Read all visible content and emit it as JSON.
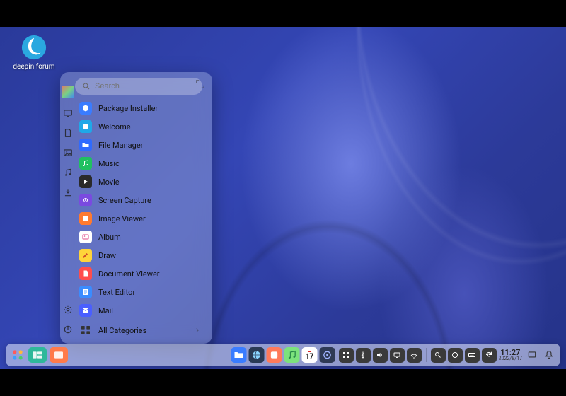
{
  "desktop_shortcut": {
    "label": "deepin forum"
  },
  "launcher": {
    "search_placeholder": "Search",
    "apps": [
      {
        "label": "Package Installer",
        "icon": "package-installer-icon",
        "bg": "#3a7cff"
      },
      {
        "label": "Welcome",
        "icon": "welcome-icon",
        "bg": "#1fa8e8"
      },
      {
        "label": "File Manager",
        "icon": "file-manager-icon",
        "bg": "#2f6bff"
      },
      {
        "label": "Music",
        "icon": "music-icon",
        "bg": "#20c060"
      },
      {
        "label": "Movie",
        "icon": "movie-icon",
        "bg": "#2a2a2a"
      },
      {
        "label": "Screen Capture",
        "icon": "screen-capture-icon",
        "bg": "#7a4ae0"
      },
      {
        "label": "Image Viewer",
        "icon": "image-viewer-icon",
        "bg": "#ff7a2f"
      },
      {
        "label": "Album",
        "icon": "album-icon",
        "bg": "#ffffff"
      },
      {
        "label": "Draw",
        "icon": "draw-icon",
        "bg": "#ffd43a"
      },
      {
        "label": "Document Viewer",
        "icon": "document-viewer-icon",
        "bg": "#ff4d4d"
      },
      {
        "label": "Text Editor",
        "icon": "text-editor-icon",
        "bg": "#3a8cff"
      },
      {
        "label": "Mail",
        "icon": "mail-icon",
        "bg": "#4a5fff"
      }
    ],
    "all_categories_label": "All Categories"
  },
  "dock": {
    "center_apps": [
      {
        "name": "file-manager",
        "bg": "#3a7cff"
      },
      {
        "name": "browser",
        "bg": "#2a3a55"
      },
      {
        "name": "app-store",
        "bg": "#ff7a5a"
      },
      {
        "name": "music",
        "bg": "#7ce27c"
      },
      {
        "name": "calendar",
        "bg": "#ffffff",
        "text": "17"
      },
      {
        "name": "control-center",
        "bg": "#2f3a55"
      }
    ],
    "tray": [
      {
        "name": "grid-icon"
      },
      {
        "name": "usb-icon"
      },
      {
        "name": "volume-icon"
      },
      {
        "name": "display-icon"
      },
      {
        "name": "network-icon"
      }
    ],
    "tray2": [
      {
        "name": "search-icon"
      },
      {
        "name": "circle-icon"
      },
      {
        "name": "keyboard-icon"
      },
      {
        "name": "refresh-icon"
      }
    ],
    "time": "11:27",
    "date": "2022/8/17"
  }
}
